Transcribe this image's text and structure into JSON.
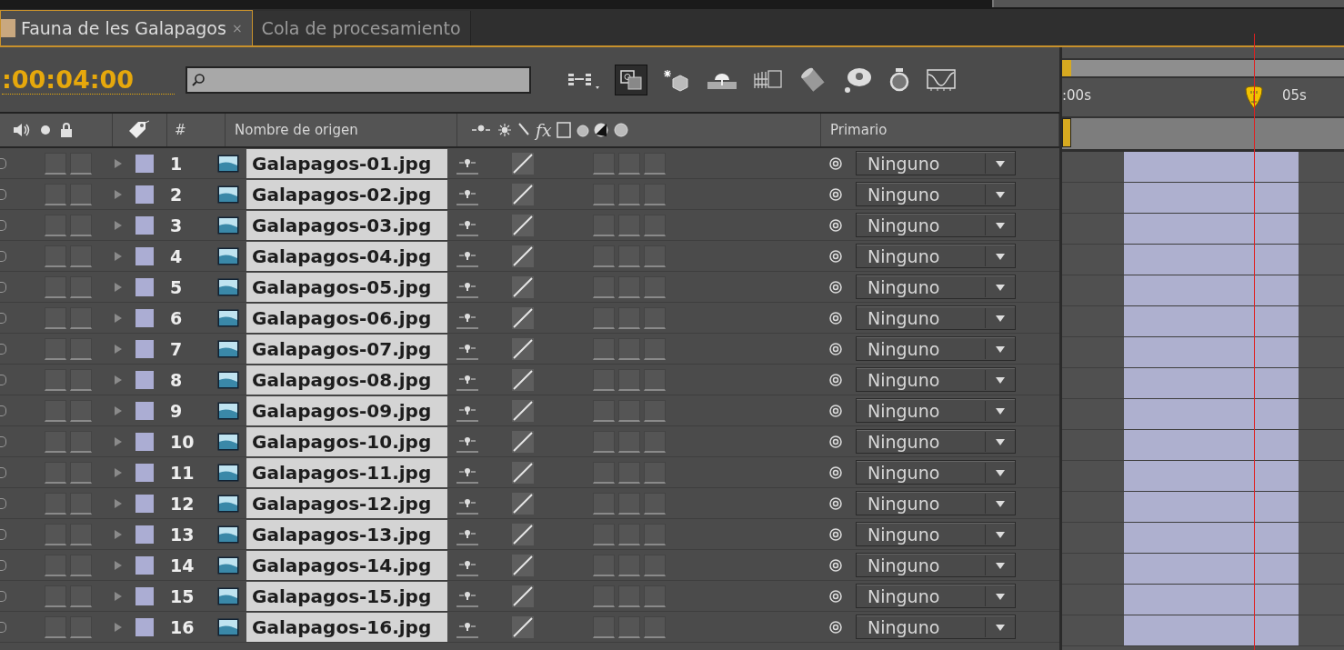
{
  "tabs": [
    {
      "label": "Fauna de les Galapagos",
      "selected": true,
      "close": "×"
    },
    {
      "label": "Cola de procesamiento",
      "selected": false
    }
  ],
  "timecode": ":00:04:00",
  "columns": {
    "number": "#",
    "source_name": "Nombre de origen",
    "effects": "fx",
    "parent": "Primario"
  },
  "ruler": {
    "start_label": ":00s",
    "tick_label": "05s",
    "playhead": {
      "level": 0.68
    }
  },
  "layers": [
    {
      "number": "1",
      "name": "Galapagos-01.jpg",
      "parent": "Ninguno"
    },
    {
      "number": "2",
      "name": "Galapagos-02.jpg",
      "parent": "Ninguno"
    },
    {
      "number": "3",
      "name": "Galapagos-03.jpg",
      "parent": "Ninguno"
    },
    {
      "number": "4",
      "name": "Galapagos-04.jpg",
      "parent": "Ninguno"
    },
    {
      "number": "5",
      "name": "Galapagos-05.jpg",
      "parent": "Ninguno"
    },
    {
      "number": "6",
      "name": "Galapagos-06.jpg",
      "parent": "Ninguno"
    },
    {
      "number": "7",
      "name": "Galapagos-07.jpg",
      "parent": "Ninguno"
    },
    {
      "number": "8",
      "name": "Galapagos-08.jpg",
      "parent": "Ninguno"
    },
    {
      "number": "9",
      "name": "Galapagos-09.jpg",
      "parent": "Ninguno"
    },
    {
      "number": "10",
      "name": "Galapagos-10.jpg",
      "parent": "Ninguno"
    },
    {
      "number": "11",
      "name": "Galapagos-11.jpg",
      "parent": "Ninguno"
    },
    {
      "number": "12",
      "name": "Galapagos-12.jpg",
      "parent": "Ninguno"
    },
    {
      "number": "13",
      "name": "Galapagos-13.jpg",
      "parent": "Ninguno"
    },
    {
      "number": "14",
      "name": "Galapagos-14.jpg",
      "parent": "Ninguno"
    },
    {
      "number": "15",
      "name": "Galapagos-15.jpg",
      "parent": "Ninguno"
    },
    {
      "number": "16",
      "name": "Galapagos-16.jpg",
      "parent": "Ninguno"
    }
  ]
}
